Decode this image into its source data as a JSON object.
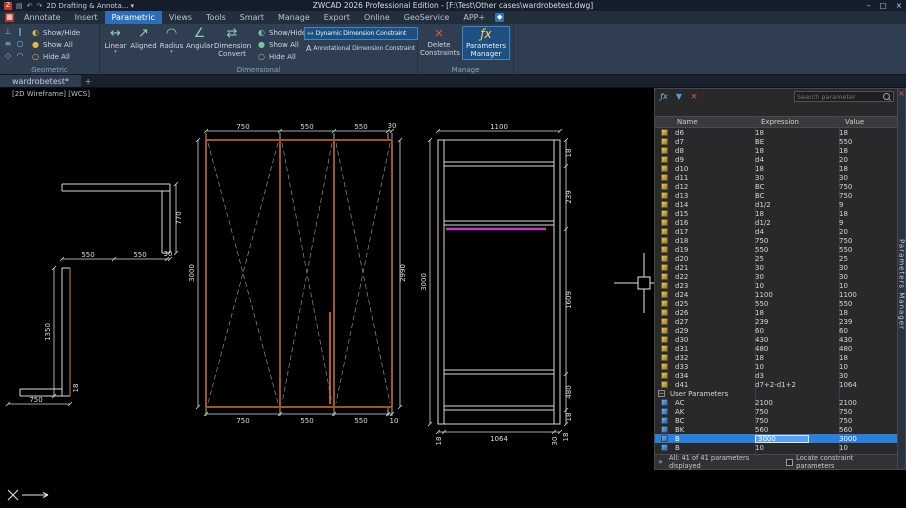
{
  "titlebar": {
    "workspace": "2D Drafting & Annota...",
    "title": "ZWCAD 2026 Professional Edition - [F:\\Test\\Other cases\\wardrobetest.dwg]"
  },
  "tabs": [
    "Annotate",
    "Insert",
    "Parametric",
    "Views",
    "Tools",
    "Smart",
    "Manage",
    "Export",
    "Online",
    "GeoService",
    "APP+"
  ],
  "active_tab": "Parametric",
  "ribbon": {
    "geometric": {
      "label": "Geometric",
      "show_hide": "Show/Hide",
      "show_all": "Show All",
      "hide_all": "Hide All"
    },
    "dimensional": {
      "label": "Dimensional",
      "linear": "Linear",
      "aligned": "Aligned",
      "radius": "Radius",
      "angular": "Angular",
      "convert": "Dimension Convert",
      "show_hide": "Show/Hide",
      "show_all": "Show All",
      "hide_all": "Hide All",
      "dynamic": "Dynamic Dimension Constraint",
      "annotational": "Annotational Dimension Constraint"
    },
    "manage": {
      "label": "Manage",
      "delete_constraints": "Delete Constraints",
      "parameters_manager": "Parameters Manager"
    }
  },
  "doc_tabs": {
    "active": "wardrobetest*",
    "new_tab": "+"
  },
  "viewport_label": "[2D Wireframe] [WCS]",
  "drawing": {
    "left_detail": {
      "dims": [
        "550",
        "550",
        "30",
        "770",
        "1350",
        "750",
        "18"
      ]
    },
    "front": {
      "top": [
        "750",
        "550",
        "550",
        "30"
      ],
      "bottom": [
        "750",
        "550",
        "550",
        "10"
      ],
      "left": "3000",
      "right": "2990"
    },
    "section": {
      "top": "1100",
      "left": "3000",
      "right": [
        "18",
        "239",
        "1609",
        "480",
        "18"
      ],
      "bottom": [
        "18",
        "1064",
        "30",
        "18"
      ]
    }
  },
  "panel": {
    "search_placeholder": "Search parameter",
    "columns": {
      "name": "Name",
      "expression": "Expression",
      "value": "Value"
    },
    "rows": [
      {
        "n": "d6",
        "e": "18",
        "v": "18"
      },
      {
        "n": "d7",
        "e": "BE",
        "v": "550"
      },
      {
        "n": "d8",
        "e": "18",
        "v": "18"
      },
      {
        "n": "d9",
        "e": "d4",
        "v": "20"
      },
      {
        "n": "d10",
        "e": "18",
        "v": "18"
      },
      {
        "n": "d11",
        "e": "30",
        "v": "30"
      },
      {
        "n": "d12",
        "e": "BC",
        "v": "750"
      },
      {
        "n": "d13",
        "e": "BC",
        "v": "750"
      },
      {
        "n": "d14",
        "e": "d1/2",
        "v": "9"
      },
      {
        "n": "d15",
        "e": "18",
        "v": "18"
      },
      {
        "n": "d16",
        "e": "d1/2",
        "v": "9"
      },
      {
        "n": "d17",
        "e": "d4",
        "v": "20"
      },
      {
        "n": "d18",
        "e": "750",
        "v": "750"
      },
      {
        "n": "d19",
        "e": "550",
        "v": "550"
      },
      {
        "n": "d20",
        "e": "25",
        "v": "25"
      },
      {
        "n": "d21",
        "e": "30",
        "v": "30"
      },
      {
        "n": "d22",
        "e": "30",
        "v": "30"
      },
      {
        "n": "d23",
        "e": "10",
        "v": "10"
      },
      {
        "n": "d24",
        "e": "1100",
        "v": "1100"
      },
      {
        "n": "d25",
        "e": "550",
        "v": "550"
      },
      {
        "n": "d26",
        "e": "18",
        "v": "18"
      },
      {
        "n": "d27",
        "e": "239",
        "v": "239"
      },
      {
        "n": "d29",
        "e": "60",
        "v": "60"
      },
      {
        "n": "d30",
        "e": "430",
        "v": "430"
      },
      {
        "n": "d31",
        "e": "480",
        "v": "480"
      },
      {
        "n": "d32",
        "e": "18",
        "v": "18"
      },
      {
        "n": "d33",
        "e": "10",
        "v": "10"
      },
      {
        "n": "d34",
        "e": "d3",
        "v": "30"
      },
      {
        "n": "d41",
        "e": "d7+2-d1+2",
        "v": "1064"
      },
      {
        "g": "User Parameters"
      },
      {
        "n": "AC",
        "e": "2100",
        "v": "2100",
        "u": true
      },
      {
        "n": "AK",
        "e": "750",
        "v": "750",
        "u": true
      },
      {
        "n": "BC",
        "e": "750",
        "v": "750",
        "u": true
      },
      {
        "n": "BK",
        "e": "560",
        "v": "560",
        "u": true
      },
      {
        "n": "B",
        "e": "3000",
        "v": "3000",
        "u": true,
        "sel": true,
        "edit": true
      },
      {
        "n": "B",
        "e": "10",
        "v": "10",
        "u": true
      }
    ],
    "status_left": "All: 41 of 41 parameters displayed",
    "locate_label": "Locate constraint parameters",
    "strip_title": "Parameters Manager"
  },
  "icons": {
    "app_glyph": "Z",
    "qat": [
      "▤",
      "↶",
      "↷"
    ],
    "caret": "▾",
    "min": "–",
    "max": "□",
    "close": "×",
    "geo": [
      "⊥",
      "∥",
      "≡",
      "○",
      "◇",
      "◠"
    ],
    "linear": "↔",
    "aligned": "↗",
    "radius": "◠",
    "angular": "∠",
    "convert": "⇄",
    "show_hide": "◐",
    "show_all": "●",
    "hide_all": "○",
    "dynamic": "↔",
    "annotational": "A",
    "delete": "×",
    "fx": "ƒx",
    "plus": "+",
    "chevron": "»",
    "group_collapse": "−",
    "app_menu": "▦",
    "addon": "◆",
    "funnel": "▼"
  }
}
